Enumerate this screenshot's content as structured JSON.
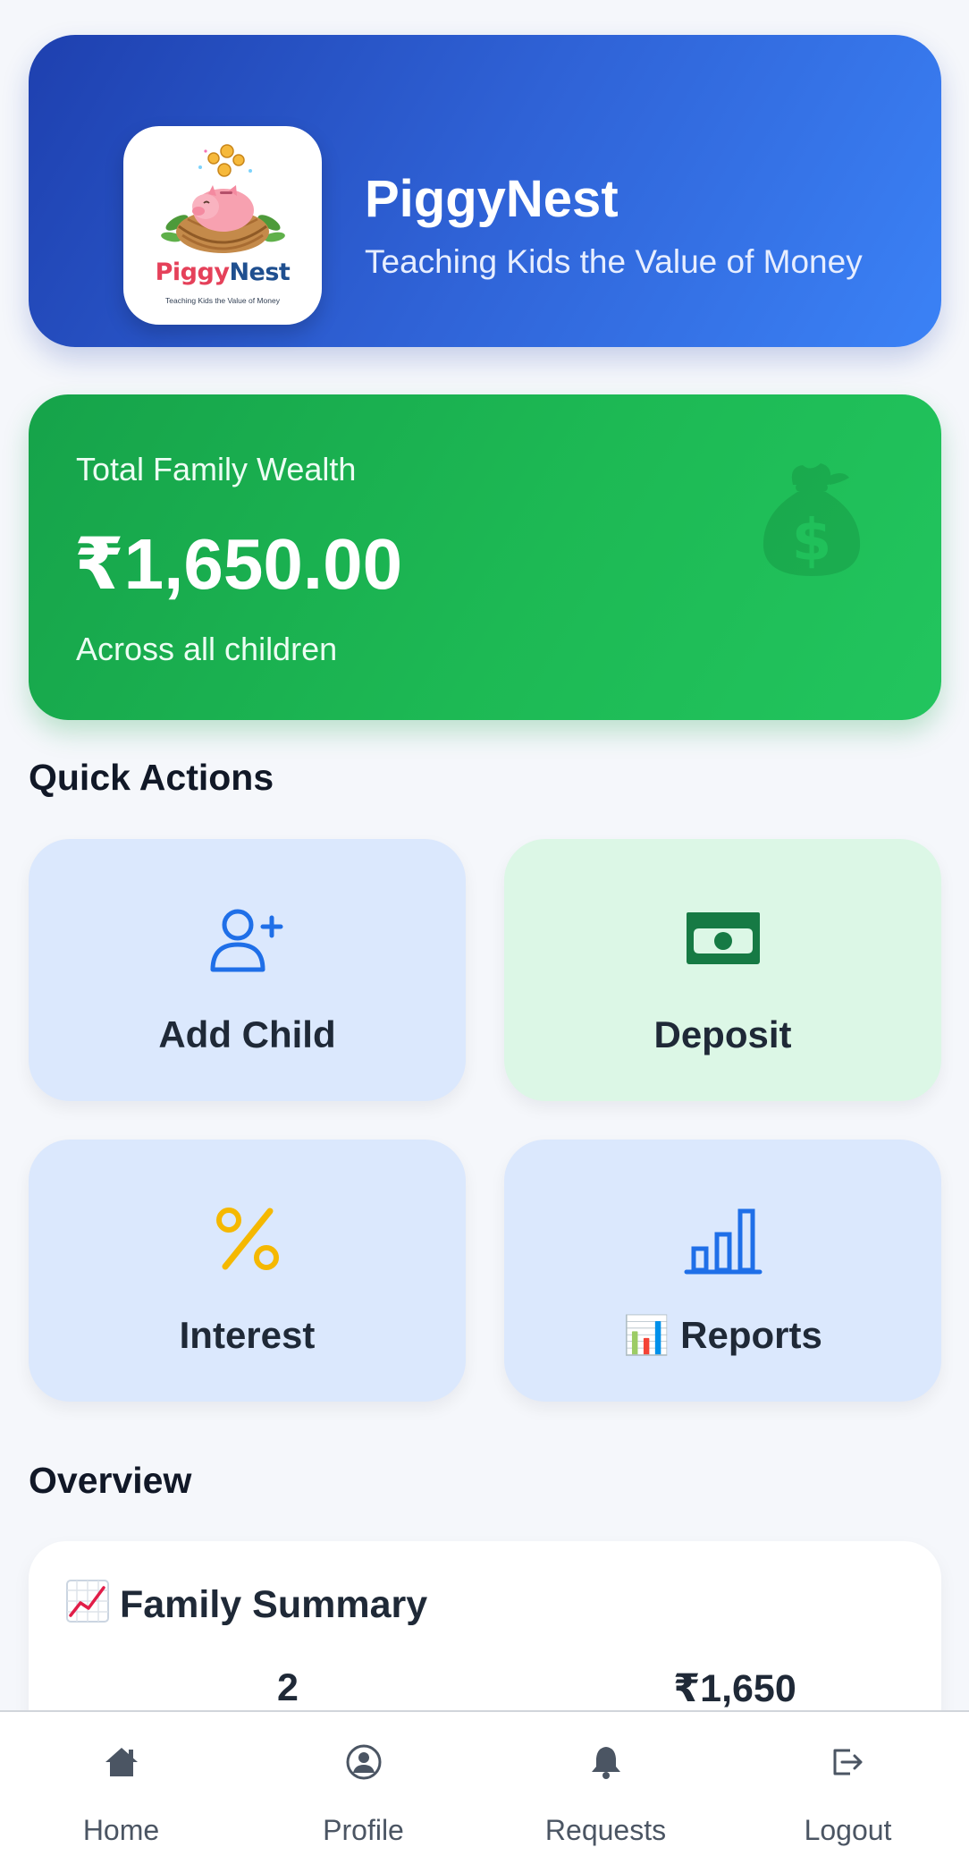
{
  "app": {
    "title": "PiggyNest",
    "subtitle": "Teaching Kids the Value of Money",
    "logo": {
      "word_part1": "Piggy",
      "word_part2": "Nest",
      "tagline": "Teaching Kids the Value of Money",
      "icon": "piggy-bank-nest-logo"
    }
  },
  "wealth": {
    "label": "Total Family Wealth",
    "amount": "₹1,650.00",
    "note": "Across all children",
    "icon": "money-bag-icon"
  },
  "quick_actions": {
    "title": "Quick Actions",
    "items": [
      {
        "label": "Add Child",
        "icon": "add-user-icon",
        "color": "#1f6fe8"
      },
      {
        "label": "Deposit",
        "icon": "cash-icon",
        "color": "#15803d"
      },
      {
        "label": "Interest",
        "icon": "percent-icon",
        "color": "#f5b800"
      },
      {
        "label": "📊 Reports",
        "icon": "bar-chart-icon",
        "color": "#1f6fe8"
      }
    ]
  },
  "overview": {
    "title": "Overview",
    "summary": {
      "title": "Family Summary",
      "icon": "chart-increasing-emoji",
      "stats": [
        {
          "value": "2"
        },
        {
          "value": "₹1,650"
        }
      ]
    }
  },
  "nav": {
    "items": [
      {
        "label": "Home",
        "icon": "home-icon"
      },
      {
        "label": "Profile",
        "icon": "profile-icon"
      },
      {
        "label": "Requests",
        "icon": "bell-icon"
      },
      {
        "label": "Logout",
        "icon": "logout-icon"
      }
    ]
  },
  "colors": {
    "header_gradient_start": "#1e40af",
    "header_gradient_end": "#3b82f6",
    "wealth_gradient_start": "#16a34a",
    "wealth_gradient_end": "#22c55e",
    "tile_blue": "#dbe8fd",
    "tile_green": "#dcf7e6",
    "page_background": "#f5f7fb"
  }
}
